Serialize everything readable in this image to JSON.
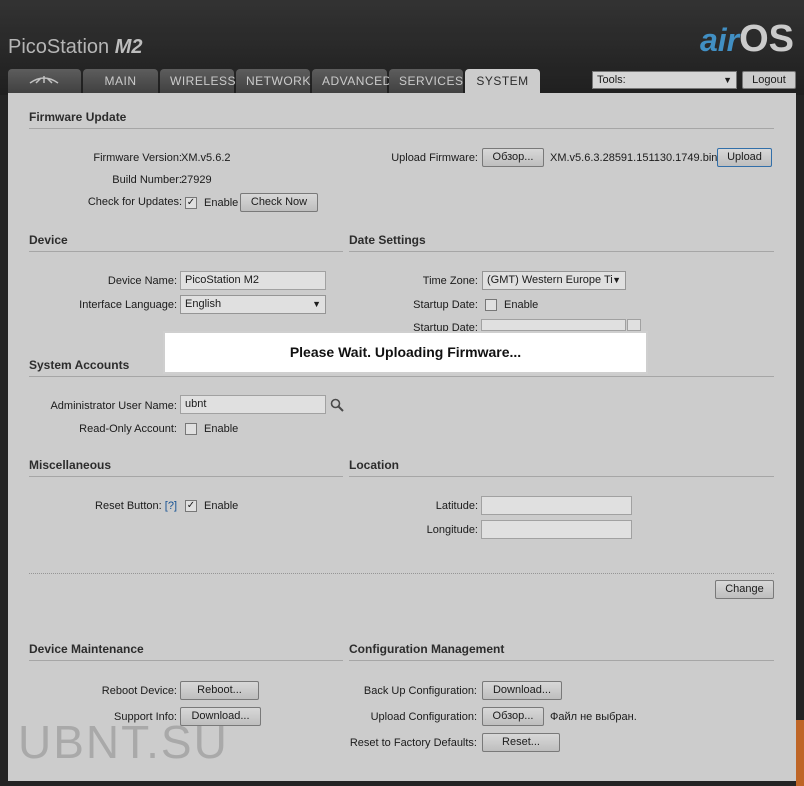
{
  "header": {
    "brand_main": "PicoStation",
    "brand_model": "M2",
    "airos_prefix": "air",
    "airos_suffix": "OS"
  },
  "tabs": [
    {
      "label": ""
    },
    {
      "label": "MAIN"
    },
    {
      "label": "WIRELESS"
    },
    {
      "label": "NETWORK"
    },
    {
      "label": "ADVANCED"
    },
    {
      "label": "SERVICES"
    },
    {
      "label": "SYSTEM"
    }
  ],
  "toolbar": {
    "tools_value": "Tools:",
    "logout_label": "Logout"
  },
  "firmware": {
    "section_title": "Firmware Update",
    "version_label": "Firmware Version:",
    "version_value": "XM.v5.6.2",
    "build_label": "Build Number:",
    "build_value": "27929",
    "check_label": "Check for Updates:",
    "check_enable": "Enable",
    "check_now_button": "Check Now",
    "upload_label": "Upload Firmware:",
    "browse_button": "Обзор...",
    "file_name": "XM.v5.6.3.28591.151130.1749.bin",
    "upload_button": "Upload"
  },
  "device": {
    "section_title": "Device",
    "name_label": "Device Name:",
    "name_value": "PicoStation M2",
    "lang_label": "Interface Language:",
    "lang_value": "English"
  },
  "date": {
    "section_title": "Date Settings",
    "tz_label": "Time Zone:",
    "tz_value": "(GMT) Western Europe Ti",
    "startup_label": "Startup Date:",
    "startup_enable": "Enable",
    "startup_date_label": "Startup Date:"
  },
  "accounts": {
    "section_title": "System Accounts",
    "admin_label": "Administrator User Name:",
    "admin_value": "ubnt",
    "readonly_label": "Read-Only Account:",
    "readonly_enable": "Enable"
  },
  "misc": {
    "section_title": "Miscellaneous",
    "reset_label": "Reset Button:",
    "reset_help": "[?]",
    "reset_enable": "Enable"
  },
  "location": {
    "section_title": "Location",
    "lat_label": "Latitude:",
    "lon_label": "Longitude:"
  },
  "change_button": "Change",
  "maintenance": {
    "section_title": "Device Maintenance",
    "reboot_label": "Reboot Device:",
    "reboot_button": "Reboot...",
    "support_label": "Support Info:",
    "support_button": "Download..."
  },
  "config": {
    "section_title": "Configuration Management",
    "backup_label": "Back Up Configuration:",
    "backup_button": "Download...",
    "upload_label": "Upload Configuration:",
    "browse_button": "Обзор...",
    "no_file": "Файл не выбран.",
    "factory_label": "Reset to Factory Defaults:",
    "factory_button": "Reset..."
  },
  "modal": {
    "message": "Please Wait. Uploading Firmware..."
  },
  "watermark": "UBNT.SU"
}
